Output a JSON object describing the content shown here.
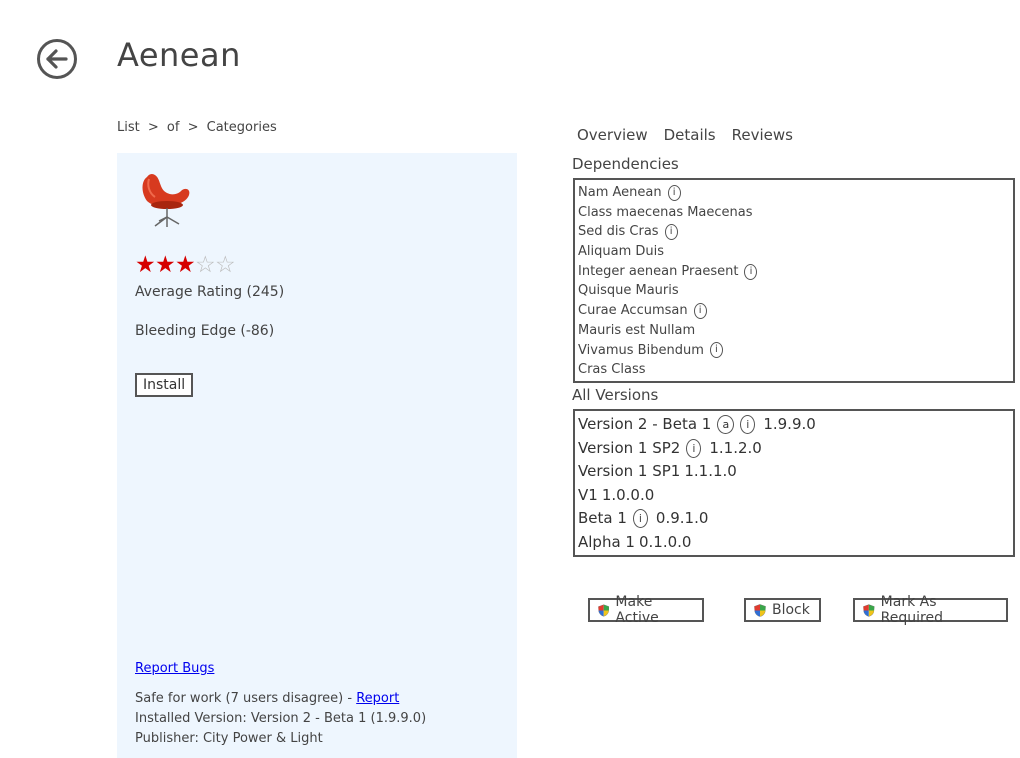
{
  "header": {
    "title": "Aenean",
    "back_icon": "back-arrow-icon"
  },
  "breadcrumb": [
    "List",
    "of",
    "Categories"
  ],
  "breadcrumb_separator": ">",
  "app": {
    "icon": "red-chair-icon",
    "rating_stars": 3,
    "rating_max": 5,
    "average_rating_text": "Average Rating (245)",
    "bleeding_edge_text": "Bleeding Edge (-86)",
    "install_label": "Install",
    "report_bugs_label": "Report Bugs",
    "safe_for_work_text": "Safe for work (7 users disagree) - ",
    "report_link_label": "Report",
    "installed_version_text": "Installed Version: Version 2 - Beta 1 (1.9.9.0)",
    "publisher_text": "Publisher: City Power & Light"
  },
  "tabs": [
    "Overview",
    "Details",
    "Reviews"
  ],
  "dependencies": {
    "label": "Dependencies",
    "items": [
      {
        "name": "Nam Aenean",
        "info": true
      },
      {
        "name": "Class maecenas Maecenas",
        "info": false
      },
      {
        "name": "Sed dis Cras",
        "info": true
      },
      {
        "name": "Aliquam Duis",
        "info": false
      },
      {
        "name": "Integer aenean Praesent",
        "info": true
      },
      {
        "name": "Quisque Mauris",
        "info": false
      },
      {
        "name": "Curae Accumsan",
        "info": true
      },
      {
        "name": "Mauris est Nullam",
        "info": false
      },
      {
        "name": "Vivamus Bibendum",
        "info": true
      },
      {
        "name": "Cras Class",
        "info": false
      }
    ]
  },
  "versions": {
    "label": "All Versions",
    "items": [
      {
        "name": "Version 2 - Beta 1",
        "badge": "a",
        "info": true,
        "version": "1.9.9.0"
      },
      {
        "name": "Version 1 SP2",
        "badge": "",
        "info": true,
        "version": "1.1.2.0"
      },
      {
        "name": "Version 1 SP1",
        "badge": "",
        "info": false,
        "version": "1.1.1.0"
      },
      {
        "name": "V1",
        "badge": "",
        "info": false,
        "version": "1.0.0.0"
      },
      {
        "name": "Beta 1",
        "badge": "",
        "info": true,
        "version": "0.9.1.0"
      },
      {
        "name": "Alpha 1",
        "badge": "",
        "info": false,
        "version": "0.1.0.0"
      }
    ]
  },
  "actions": {
    "make_active_label": "Make Active",
    "block_label": "Block",
    "mark_required_label": "Mark As Required",
    "button_icon": "shield-icon"
  },
  "info_glyph": "i",
  "colors": {
    "panel_bg": "#eef6fe",
    "star_filled": "#d60000",
    "link": "#0000ee"
  }
}
